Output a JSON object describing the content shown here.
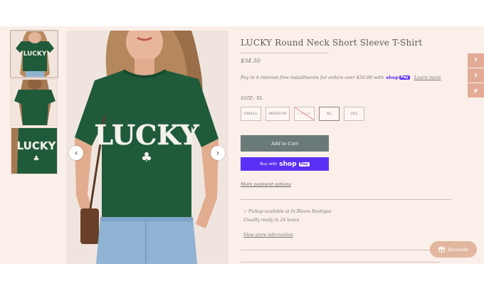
{
  "product": {
    "title": "LUCKY Round Neck Short Sleeve T-Shirt",
    "price": "$34.50",
    "shirt_print": "LUCKY",
    "shirt_color": "#1f5a3a"
  },
  "installments": {
    "text": "Pay in 4 interest-free installments for orders over $50.00 with",
    "brand_shop": "shop",
    "brand_pay": "Pay",
    "learn_more": "Learn more"
  },
  "size": {
    "label": "SIZE: XL",
    "options": [
      {
        "label": "SMALL",
        "state": "available"
      },
      {
        "label": "MEDIUM",
        "state": "available"
      },
      {
        "label": "LARGE",
        "state": "sold-out"
      },
      {
        "label": "XL",
        "state": "selected"
      },
      {
        "label": "2XL",
        "state": "available"
      }
    ]
  },
  "actions": {
    "add_to_cart": "Add to Cart",
    "buy_with": "Buy with",
    "buy_brand": "shop",
    "buy_pay": "Pay",
    "more_payment_options": "More payment options"
  },
  "pickup": {
    "line1": "Pickup available at In Bloom Boutique",
    "line2": "Usually ready in 24 hours",
    "store_link": "View store information"
  },
  "social": {
    "icons": [
      "facebook-icon",
      "twitter-icon",
      "pinterest-icon"
    ],
    "glyphs": [
      "f",
      "t",
      "p"
    ]
  },
  "rewards": {
    "label": "Rewards",
    "icon": "gift-icon"
  },
  "colors": {
    "page_bg": "#fbefe9",
    "add_to_cart": "#6a7a79",
    "shop_pay": "#5a31f4",
    "social_bg": "#e3ab96",
    "rewards_bg": "#e2b79f"
  },
  "gallery": {
    "thumbnail_count": 3,
    "active_thumbnail": 1
  }
}
